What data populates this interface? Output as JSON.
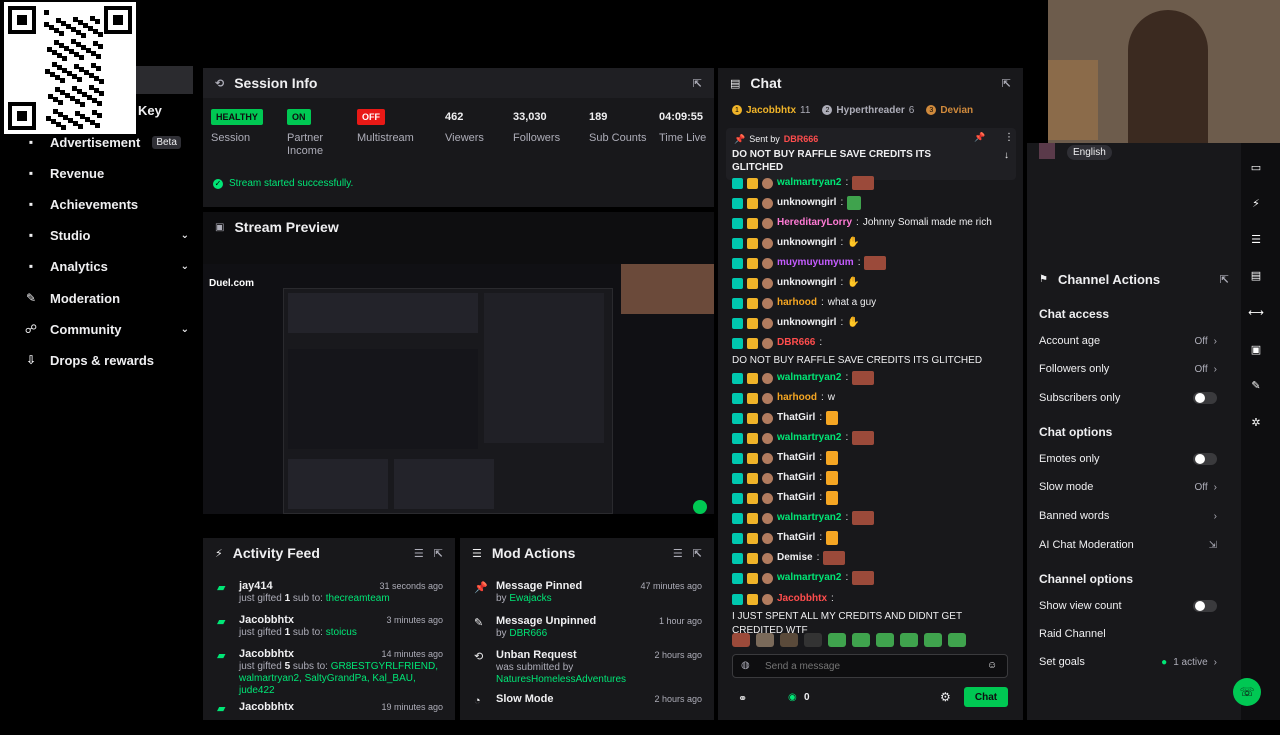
{
  "nav": {
    "key_label": "Key",
    "items": [
      {
        "label": "Advertisement",
        "icon": "megaphone-icon",
        "badge": "Beta"
      },
      {
        "label": "Revenue",
        "icon": "revenue-icon"
      },
      {
        "label": "Achievements",
        "icon": "trophy-icon"
      },
      {
        "label": "Studio",
        "icon": "studio-icon",
        "expandable": true
      },
      {
        "label": "Analytics",
        "icon": "analytics-icon",
        "expandable": true
      },
      {
        "label": "Moderation",
        "icon": "wrench-icon"
      },
      {
        "label": "Community",
        "icon": "community-icon",
        "expandable": true
      },
      {
        "label": "Drops & rewards",
        "icon": "drops-icon"
      }
    ]
  },
  "session": {
    "title": "Session Info",
    "stats": [
      {
        "value": "HEALTHY",
        "label": "Session",
        "style": "green"
      },
      {
        "value": "ON",
        "label": "Partner Income",
        "style": "green"
      },
      {
        "value": "OFF",
        "label": "Multistream",
        "style": "red"
      },
      {
        "value": "462",
        "label": "Viewers"
      },
      {
        "value": "33,030",
        "label": "Followers"
      },
      {
        "value": "189",
        "label": "Sub Counts"
      },
      {
        "value": "04:09:55",
        "label": "Time Live"
      }
    ],
    "status": "Stream started successfully."
  },
  "preview": {
    "title": "Stream Preview",
    "watermark": "Duel.com"
  },
  "activity": {
    "title": "Activity Feed",
    "items": [
      {
        "name": "jay414",
        "pre": "just gifted ",
        "count": "1",
        "mid": " sub to: ",
        "target": "thecreamteam",
        "time": "31 seconds ago"
      },
      {
        "name": "Jacobbhtx",
        "pre": "just gifted ",
        "count": "1",
        "mid": " sub to: ",
        "target": "stoicus",
        "time": "3 minutes ago"
      },
      {
        "name": "Jacobbhtx",
        "pre": "just gifted ",
        "count": "5",
        "mid": " subs to: ",
        "target": "GR8ESTGYRLFRIEND, walmartryan2, SaltyGrandPa, Kal_BAU, jude422",
        "time": "14 minutes ago"
      },
      {
        "name": "Jacobbhtx",
        "pre": "",
        "count": "",
        "mid": "",
        "target": "",
        "time": "19 minutes ago"
      }
    ]
  },
  "modactions": {
    "title": "Mod Actions",
    "items": [
      {
        "title": "Message Pinned",
        "by": "by ",
        "who": "Ewajacks",
        "time": "47 minutes ago",
        "icon": "pin-icon"
      },
      {
        "title": "Message Unpinned",
        "by": "by ",
        "who": "DBR666",
        "time": "1 hour ago",
        "icon": "unpin-icon"
      },
      {
        "title": "Unban Request",
        "by": "was submitted by ",
        "who": "NaturesHomelessAdventures",
        "time": "2 hours ago",
        "icon": "unban-icon"
      },
      {
        "title": "Slow Mode",
        "by": "",
        "who": "",
        "time": "2 hours ago",
        "icon": "clock-icon"
      }
    ]
  },
  "chat": {
    "title": "Chat",
    "top_gifters": [
      {
        "name": "Jacobbhtx",
        "count": "11",
        "rank": "1"
      },
      {
        "name": "Hyperthreader",
        "count": "6",
        "rank": "2"
      },
      {
        "name": "Devian",
        "count": "",
        "rank": "3"
      }
    ],
    "pinned": {
      "sent_by": "Sent by",
      "user": "DBR666",
      "text": "DO NOT BUY RAFFLE SAVE CREDITS ITS GLITCHED"
    },
    "messages": [
      {
        "user": "walmartryan2",
        "color": "#00e676",
        "text": "",
        "emote": "face"
      },
      {
        "user": "unknowngirl",
        "color": "#efeff1",
        "text": "",
        "emote": "cube"
      },
      {
        "user": "HereditaryLorry",
        "color": "#ff7bd5",
        "text": "Johnny Somali made me rich",
        "emote": ""
      },
      {
        "user": "unknowngirl",
        "color": "#efeff1",
        "text": "",
        "emote": "wave"
      },
      {
        "user": "muymuyumyum",
        "color": "#c45cff",
        "text": "",
        "emote": "face"
      },
      {
        "user": "unknowngirl",
        "color": "#efeff1",
        "text": "",
        "emote": "wave"
      },
      {
        "user": "harhood",
        "color": "#f5a623",
        "text": "what a guy",
        "emote": ""
      },
      {
        "user": "unknowngirl",
        "color": "#efeff1",
        "text": "",
        "emote": "wave"
      },
      {
        "user": "DBR666",
        "color": "#ff4d4d",
        "text": "DO NOT BUY RAFFLE SAVE CREDITS ITS GLITCHED",
        "emote": ""
      },
      {
        "user": "walmartryan2",
        "color": "#00e676",
        "text": "",
        "emote": "face"
      },
      {
        "user": "harhood",
        "color": "#f5a623",
        "text": "w",
        "emote": ""
      },
      {
        "user": "ThatGirl",
        "color": "#efeff1",
        "text": "",
        "emote": "y"
      },
      {
        "user": "walmartryan2",
        "color": "#00e676",
        "text": "",
        "emote": "face"
      },
      {
        "user": "ThatGirl",
        "color": "#efeff1",
        "text": "",
        "emote": "y"
      },
      {
        "user": "ThatGirl",
        "color": "#efeff1",
        "text": "",
        "emote": "y"
      },
      {
        "user": "ThatGirl",
        "color": "#efeff1",
        "text": "",
        "emote": "y"
      },
      {
        "user": "walmartryan2",
        "color": "#00e676",
        "text": "",
        "emote": "face"
      },
      {
        "user": "ThatGirl",
        "color": "#efeff1",
        "text": "",
        "emote": "y"
      },
      {
        "user": "Demise",
        "color": "#efeff1",
        "text": "",
        "emote": "face"
      },
      {
        "user": "walmartryan2",
        "color": "#00e676",
        "text": "",
        "emote": "face"
      },
      {
        "user": "Jacobbhtx",
        "color": "#ff4d4d",
        "text": "I JUST SPENT ALL MY CREDITS AND DIDNT GET CREDITED WTF",
        "emote": ""
      }
    ],
    "input_placeholder": "Send a message",
    "points": "0",
    "send_label": "Chat"
  },
  "channel_actions": {
    "title": "Channel Actions",
    "language": "English",
    "sections": {
      "chat_access": "Chat access",
      "chat_options": "Chat options",
      "channel_options": "Channel options"
    },
    "account_age": {
      "label": "Account age",
      "value": "Off"
    },
    "followers_only": {
      "label": "Followers only",
      "value": "Off"
    },
    "subscribers_only": {
      "label": "Subscribers only"
    },
    "emotes_only": {
      "label": "Emotes only"
    },
    "slow_mode": {
      "label": "Slow mode",
      "value": "Off"
    },
    "banned_words": {
      "label": "Banned words"
    },
    "ai_moderation": {
      "label": "AI Chat Moderation"
    },
    "show_view_count": {
      "label": "Show view count"
    },
    "raid_channel": {
      "label": "Raid Channel"
    },
    "set_goals": {
      "label": "Set goals",
      "value": "1 active"
    }
  },
  "colors": {
    "accent": "#00e676",
    "panel": "#18181b",
    "danger": "#e91916"
  }
}
